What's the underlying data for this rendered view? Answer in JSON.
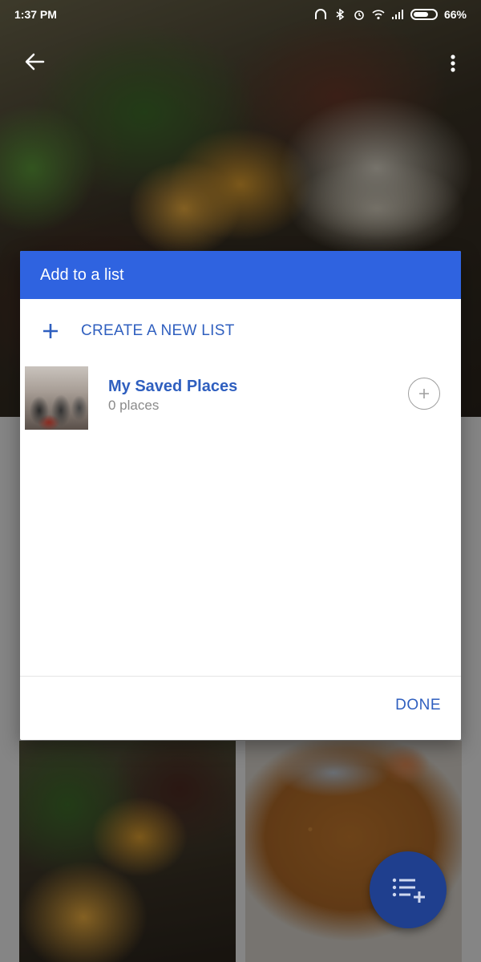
{
  "status_bar": {
    "time": "1:37 PM",
    "battery": "66%"
  },
  "dialog": {
    "title": "Add to a list",
    "create_label": "CREATE A NEW LIST",
    "lists": [
      {
        "name": "My Saved Places",
        "count": "0 places"
      }
    ],
    "done_label": "DONE"
  },
  "icons": {
    "back": "back-arrow-icon",
    "menu": "more-vert-icon",
    "create": "plus-icon",
    "add_to_list": "add-circle-icon",
    "fab": "add-to-list-icon"
  },
  "colors": {
    "dialog_header": "#2f63e0",
    "accent_text": "#2f5fbf",
    "fab": "#1f3f8e"
  }
}
